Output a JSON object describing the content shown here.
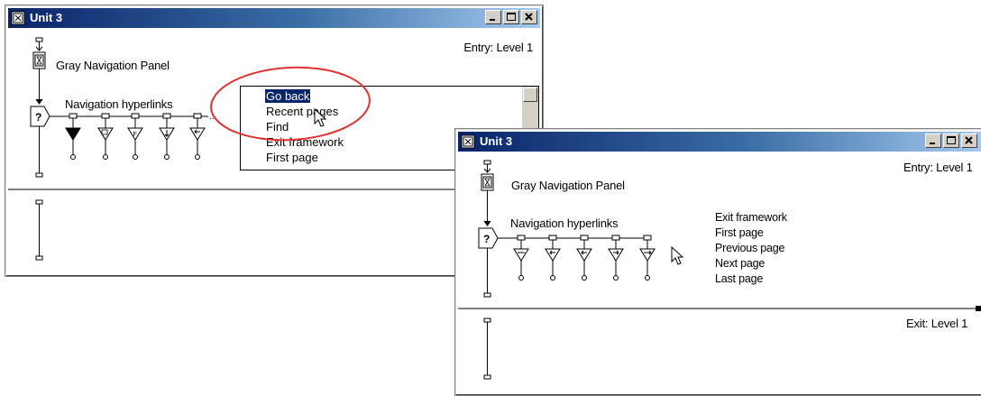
{
  "back_window": {
    "title": "Unit 3",
    "entry_label": "Entry: Level 1",
    "icon_label": "Gray Navigation Panel",
    "decision_label": "Navigation hyperlinks",
    "decision_glyph": "?",
    "cut_label": "I",
    "menu_items": [
      "Go back",
      "Recent pages",
      "Find",
      "Exit framework",
      "First page"
    ],
    "selected_item": "Go back"
  },
  "front_window": {
    "title": "Unit 3",
    "entry_label": "Entry: Level 1",
    "exit_label": "Exit: Level 1",
    "icon_label": "Gray Navigation Panel",
    "decision_label": "Navigation hyperlinks",
    "decision_glyph": "?",
    "list_items": [
      "Exit framework",
      "First page",
      "Previous page",
      "Next page",
      "Last page"
    ]
  },
  "colors": {
    "title_bar": "#0a246a",
    "highlight_circle": "#e03030",
    "selection": "#0a246a"
  }
}
